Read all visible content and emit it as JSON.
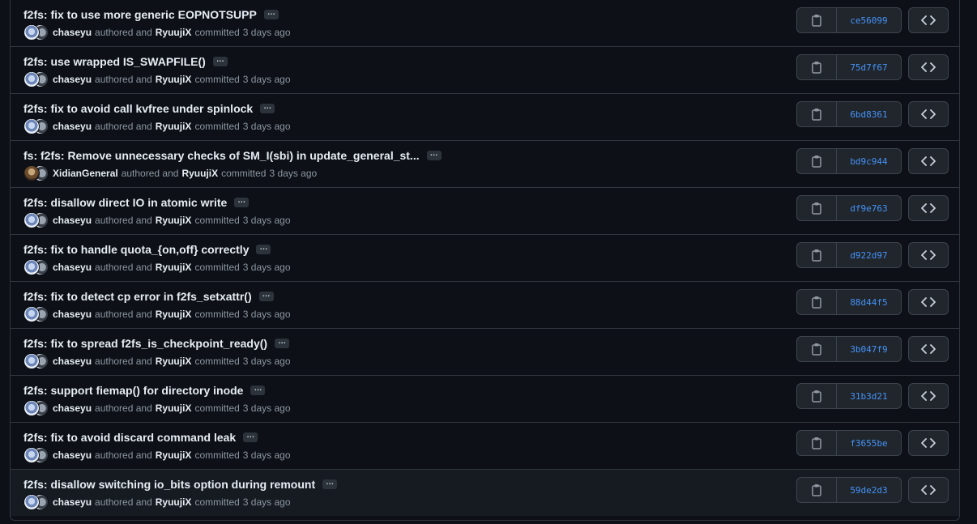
{
  "ellipsis_label": "…",
  "labels": {
    "authored": "authored and",
    "committed": "committed"
  },
  "commits": [
    {
      "title": "f2fs: fix to use more generic EOPNOTSUPP",
      "author": "chaseyu",
      "committer": "RyuujiX",
      "time": "3 days ago",
      "sha": "ce56099"
    },
    {
      "title": "f2fs: use wrapped IS_SWAPFILE()",
      "author": "chaseyu",
      "committer": "RyuujiX",
      "time": "3 days ago",
      "sha": "75d7f67"
    },
    {
      "title": "f2fs: fix to avoid call kvfree under spinlock",
      "author": "chaseyu",
      "committer": "RyuujiX",
      "time": "3 days ago",
      "sha": "6bd8361"
    },
    {
      "title": "fs: f2fs: Remove unnecessary checks of SM_I(sbi) in update_general_st...",
      "author": "XidianGeneral",
      "committer": "RyuujiX",
      "time": "3 days ago",
      "sha": "bd9c944"
    },
    {
      "title": "f2fs: disallow direct IO in atomic write",
      "author": "chaseyu",
      "committer": "RyuujiX",
      "time": "3 days ago",
      "sha": "df9e763"
    },
    {
      "title": "f2fs: fix to handle quota_{on,off} correctly",
      "author": "chaseyu",
      "committer": "RyuujiX",
      "time": "3 days ago",
      "sha": "d922d97"
    },
    {
      "title": "f2fs: fix to detect cp error in f2fs_setxattr()",
      "author": "chaseyu",
      "committer": "RyuujiX",
      "time": "3 days ago",
      "sha": "88d44f5"
    },
    {
      "title": "f2fs: fix to spread f2fs_is_checkpoint_ready()",
      "author": "chaseyu",
      "committer": "RyuujiX",
      "time": "3 days ago",
      "sha": "3b047f9"
    },
    {
      "title": "f2fs: support fiemap() for directory inode",
      "author": "chaseyu",
      "committer": "RyuujiX",
      "time": "3 days ago",
      "sha": "31b3d21"
    },
    {
      "title": "f2fs: fix to avoid discard command leak",
      "author": "chaseyu",
      "committer": "RyuujiX",
      "time": "3 days ago",
      "sha": "f3655be"
    },
    {
      "title": "f2fs: disallow switching io_bits option during remount",
      "author": "chaseyu",
      "committer": "RyuujiX",
      "time": "3 days ago",
      "sha": "59de2d3"
    }
  ],
  "icons": {
    "copy": "copy-icon",
    "browse": "code-icon",
    "avatar": "avatar"
  },
  "colors": {
    "background": "#0d1117",
    "border": "#30363d",
    "sha_link": "#4493f8",
    "muted_text": "#8d96a0"
  }
}
